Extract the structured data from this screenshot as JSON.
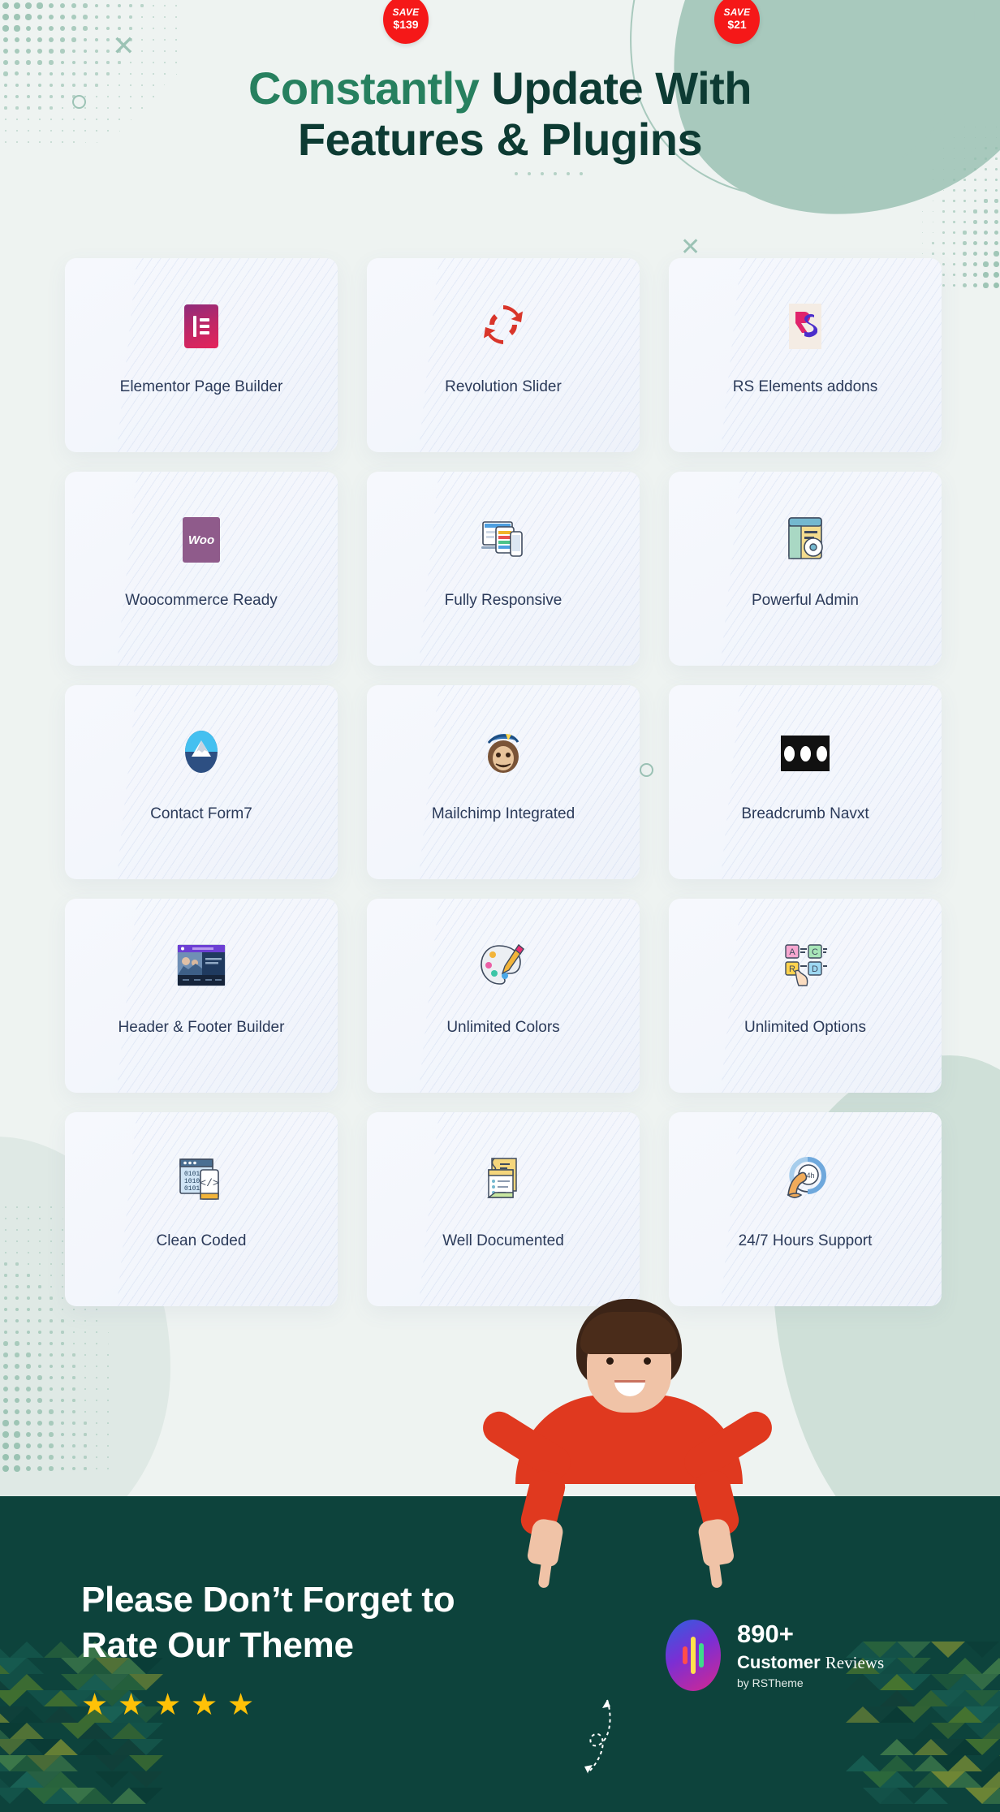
{
  "heading": {
    "highlight": "Constantly",
    "rest": " Update With",
    "line2": "Features & Plugins"
  },
  "features": [
    {
      "label": "Elementor Page Builder",
      "icon": "elementor-icon",
      "badge": null
    },
    {
      "label": "Revolution Slider",
      "icon": "revolution-slider-icon",
      "badge": {
        "top": "SAVE",
        "amount": "$139"
      }
    },
    {
      "label": "RS Elements addons",
      "icon": "rs-elements-icon",
      "badge": {
        "top": "SAVE",
        "amount": "$21"
      }
    },
    {
      "label": "Woocommerce Ready",
      "icon": "woocommerce-icon",
      "badge": null
    },
    {
      "label": "Fully Responsive",
      "icon": "responsive-devices-icon",
      "badge": null
    },
    {
      "label": "Powerful Admin",
      "icon": "admin-settings-icon",
      "badge": null
    },
    {
      "label": "Contact Form7",
      "icon": "contact-form7-icon",
      "badge": null
    },
    {
      "label": "Mailchimp Integrated",
      "icon": "mailchimp-monkey-icon",
      "badge": null
    },
    {
      "label": "Breadcrumb Navxt",
      "icon": "breadcrumb-navxt-icon",
      "badge": null
    },
    {
      "label": "Header & Footer Builder",
      "icon": "header-footer-builder-icon",
      "badge": null
    },
    {
      "label": "Unlimited Colors",
      "icon": "color-palette-icon",
      "badge": null
    },
    {
      "label": "Unlimited Options",
      "icon": "options-selection-icon",
      "badge": null
    },
    {
      "label": "Clean Coded",
      "icon": "clean-code-icon",
      "badge": null
    },
    {
      "label": "Well Documented",
      "icon": "documentation-icon",
      "badge": null
    },
    {
      "label": "24/7 Hours Support",
      "icon": "support-24h-icon",
      "badge": null
    }
  ],
  "banner": {
    "title_line1": "Please Don’t Forget to",
    "title_line2": "Rate Our Theme",
    "rating_stars": 5,
    "star_glyph": "★",
    "review": {
      "count": "890+",
      "label_bold": "Customer ",
      "label_serif": "Reviews",
      "byline": "by RSTheme"
    }
  },
  "colors": {
    "page_bg": "#eef3f1",
    "heading_dark": "#0d3b33",
    "heading_accent": "#27805f",
    "card_bg": "#f4f7fd",
    "card_label": "#2b3a59",
    "badge_red": "#f51818",
    "banner_bg": "#0d433c",
    "star_gold": "#ffc107",
    "decor_green": "#a8c9bd"
  }
}
